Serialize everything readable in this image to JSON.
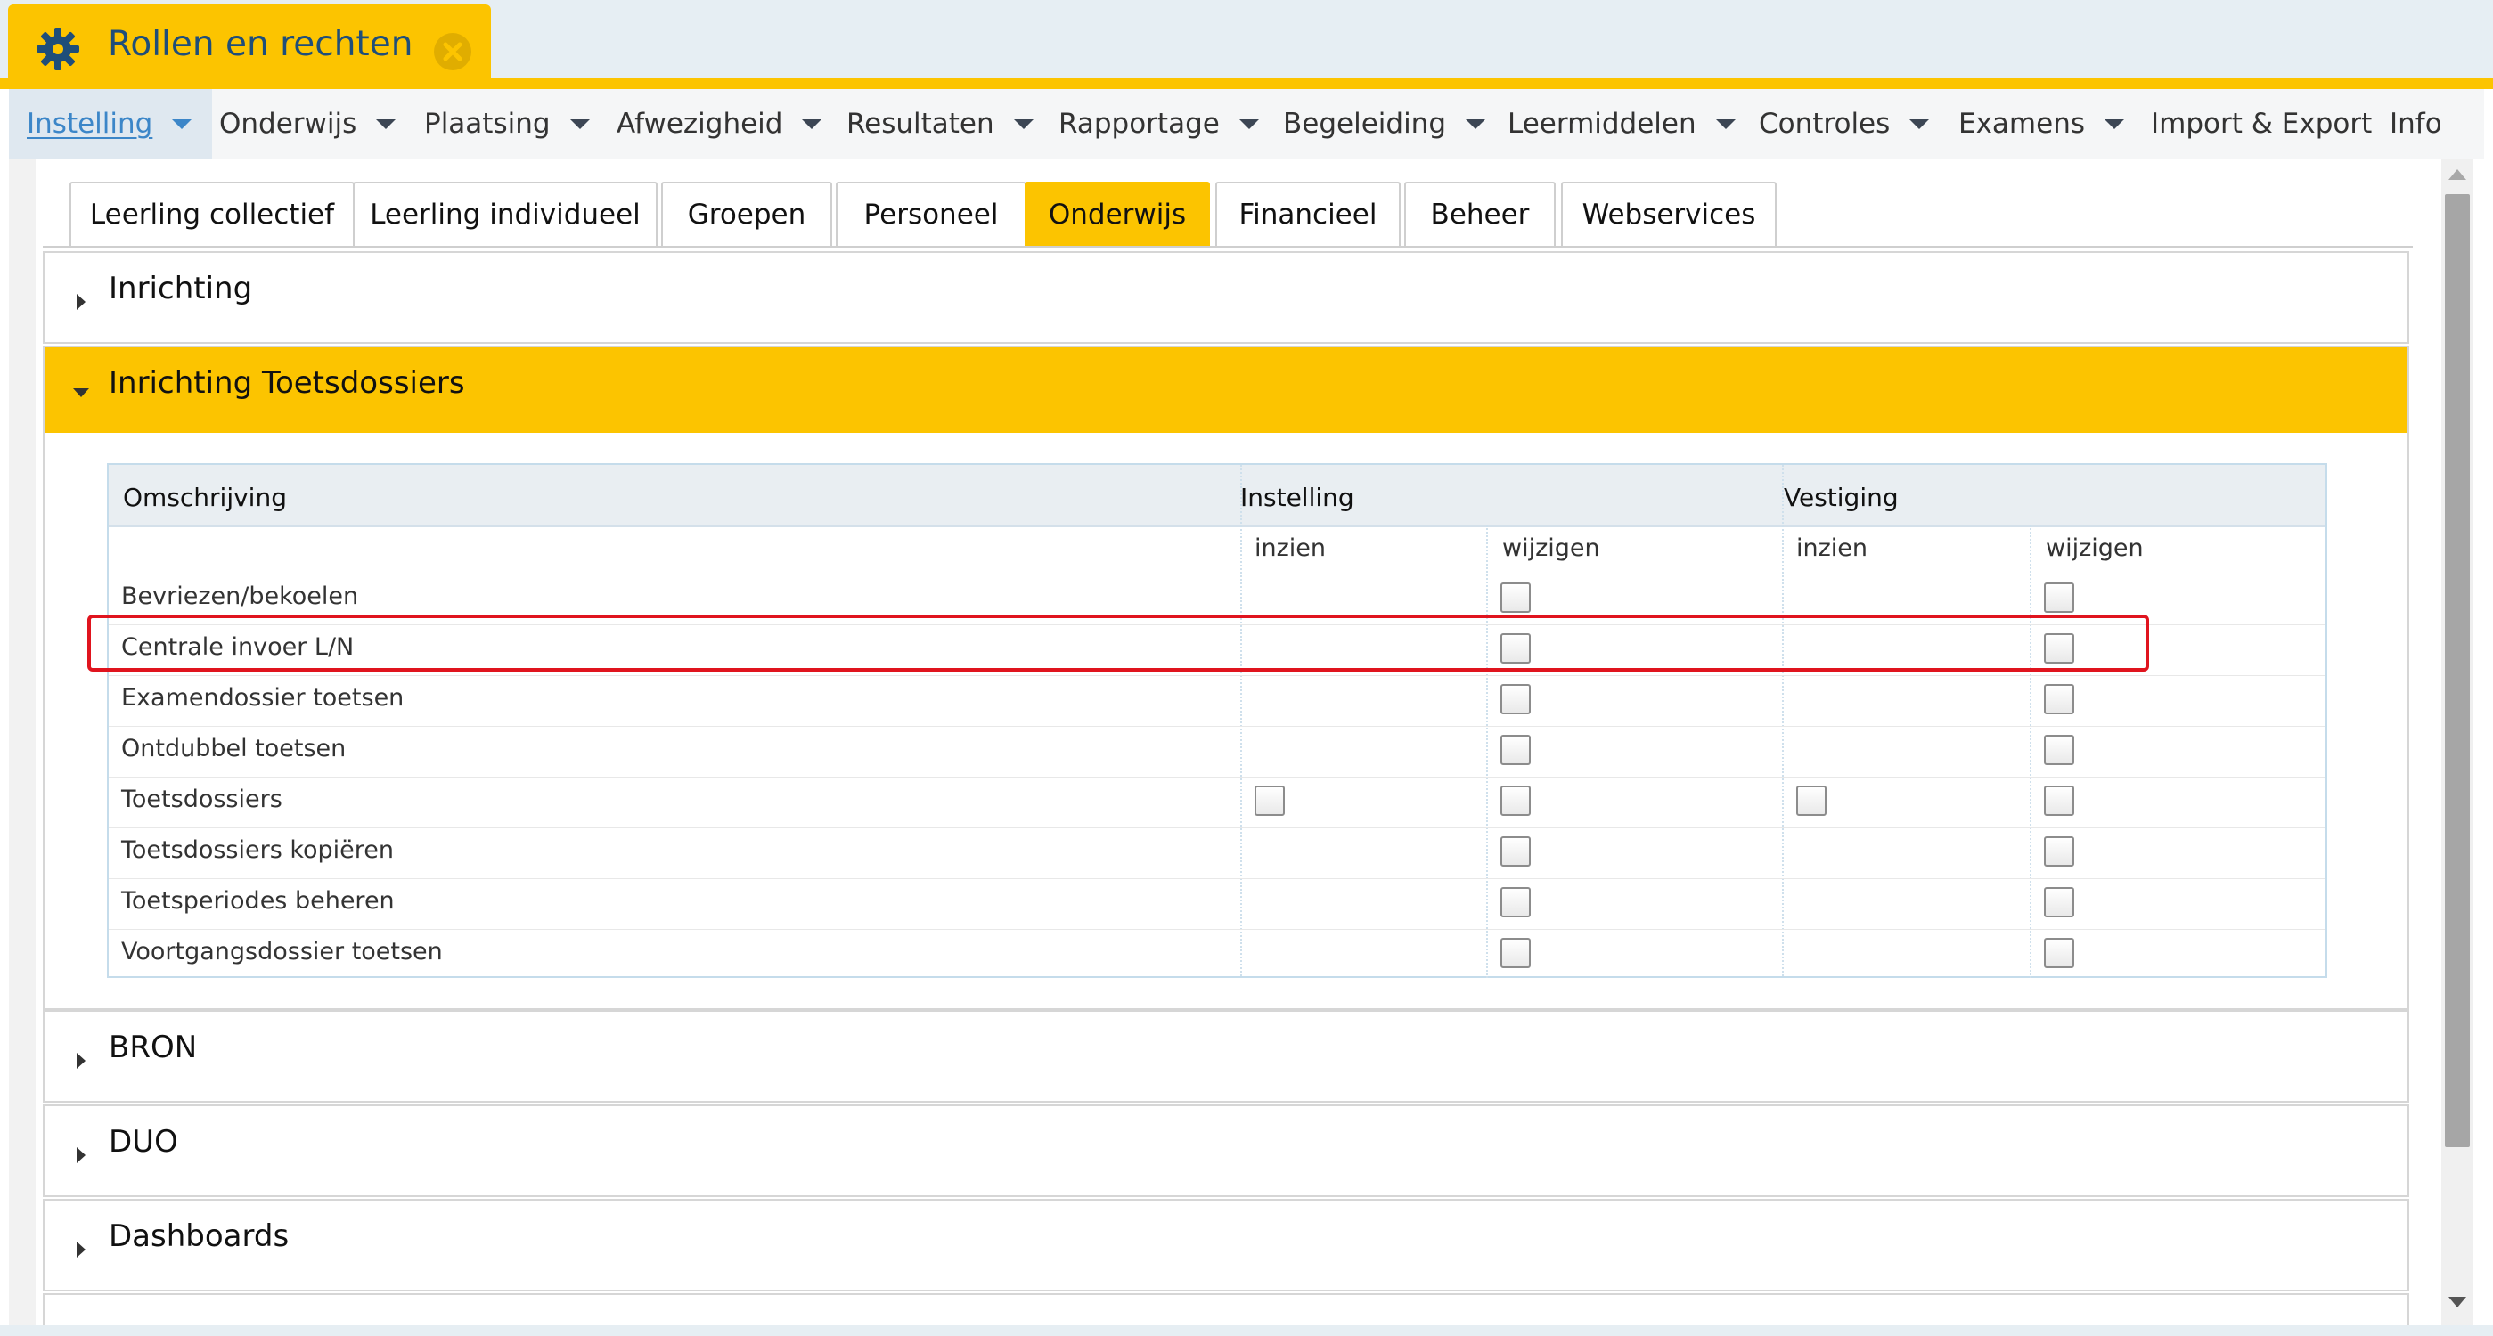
{
  "window": {
    "title": "Rollen en rechten",
    "gear_icon": "gear-icon",
    "close_icon": "close-icon",
    "accent": "#fcc400",
    "title_color": "#1f4e79"
  },
  "menu": {
    "items": [
      {
        "label": "Instelling",
        "active": true,
        "has_dropdown": true
      },
      {
        "label": "Onderwijs",
        "has_dropdown": true
      },
      {
        "label": "Plaatsing",
        "has_dropdown": true
      },
      {
        "label": "Afwezigheid",
        "has_dropdown": true
      },
      {
        "label": "Resultaten",
        "has_dropdown": true
      },
      {
        "label": "Rapportage",
        "has_dropdown": true
      },
      {
        "label": "Begeleiding",
        "has_dropdown": true
      },
      {
        "label": "Leermiddelen",
        "has_dropdown": true
      },
      {
        "label": "Controles",
        "has_dropdown": true
      },
      {
        "label": "Examens",
        "has_dropdown": true
      },
      {
        "label": "Import & Export",
        "has_dropdown": false
      },
      {
        "label": "Info",
        "has_dropdown": false
      }
    ]
  },
  "tabs": [
    {
      "label": "Leerling collectief"
    },
    {
      "label": "Leerling individueel"
    },
    {
      "label": "Groepen"
    },
    {
      "label": "Personeel"
    },
    {
      "label": "Onderwijs",
      "active": true
    },
    {
      "label": "Financieel"
    },
    {
      "label": "Beheer"
    },
    {
      "label": "Webservices"
    }
  ],
  "sections": {
    "inrichting": {
      "title": "Inrichting",
      "expanded": false
    },
    "toetsdossiers": {
      "title": "Inrichting Toetsdossiers",
      "expanded": true
    },
    "bron": {
      "title": "BRON",
      "expanded": false
    },
    "duo": {
      "title": "DUO",
      "expanded": false
    },
    "dashboards": {
      "title": "Dashboards",
      "expanded": false
    }
  },
  "table": {
    "col_description": "Omschrijving",
    "group_instelling": "Instelling",
    "group_vestiging": "Vestiging",
    "sub_inzien": "inzien",
    "sub_wijzigen": "wijzigen",
    "rows": [
      {
        "label": "Bevriezen/bekoelen",
        "inst_inzien": false,
        "inst_wijzigen": true,
        "vest_inzien": false,
        "vest_wijzigen": true
      },
      {
        "label": "Centrale invoer L/N",
        "inst_inzien": false,
        "inst_wijzigen": true,
        "vest_inzien": false,
        "vest_wijzigen": true,
        "highlighted": true
      },
      {
        "label": "Examendossier toetsen",
        "inst_inzien": false,
        "inst_wijzigen": true,
        "vest_inzien": false,
        "vest_wijzigen": true
      },
      {
        "label": "Ontdubbel toetsen",
        "inst_inzien": false,
        "inst_wijzigen": true,
        "vest_inzien": false,
        "vest_wijzigen": true
      },
      {
        "label": "Toetsdossiers",
        "inst_inzien": true,
        "inst_wijzigen": true,
        "vest_inzien": true,
        "vest_wijzigen": true
      },
      {
        "label": "Toetsdossiers kopiëren",
        "inst_inzien": false,
        "inst_wijzigen": true,
        "vest_inzien": false,
        "vest_wijzigen": true
      },
      {
        "label": "Toetsperiodes beheren",
        "inst_inzien": false,
        "inst_wijzigen": true,
        "vest_inzien": false,
        "vest_wijzigen": true
      },
      {
        "label": "Voortgangsdossier toetsen",
        "inst_inzien": false,
        "inst_wijzigen": true,
        "vest_inzien": false,
        "vest_wijzigen": true
      }
    ]
  },
  "highlight_color": "#e0141e"
}
